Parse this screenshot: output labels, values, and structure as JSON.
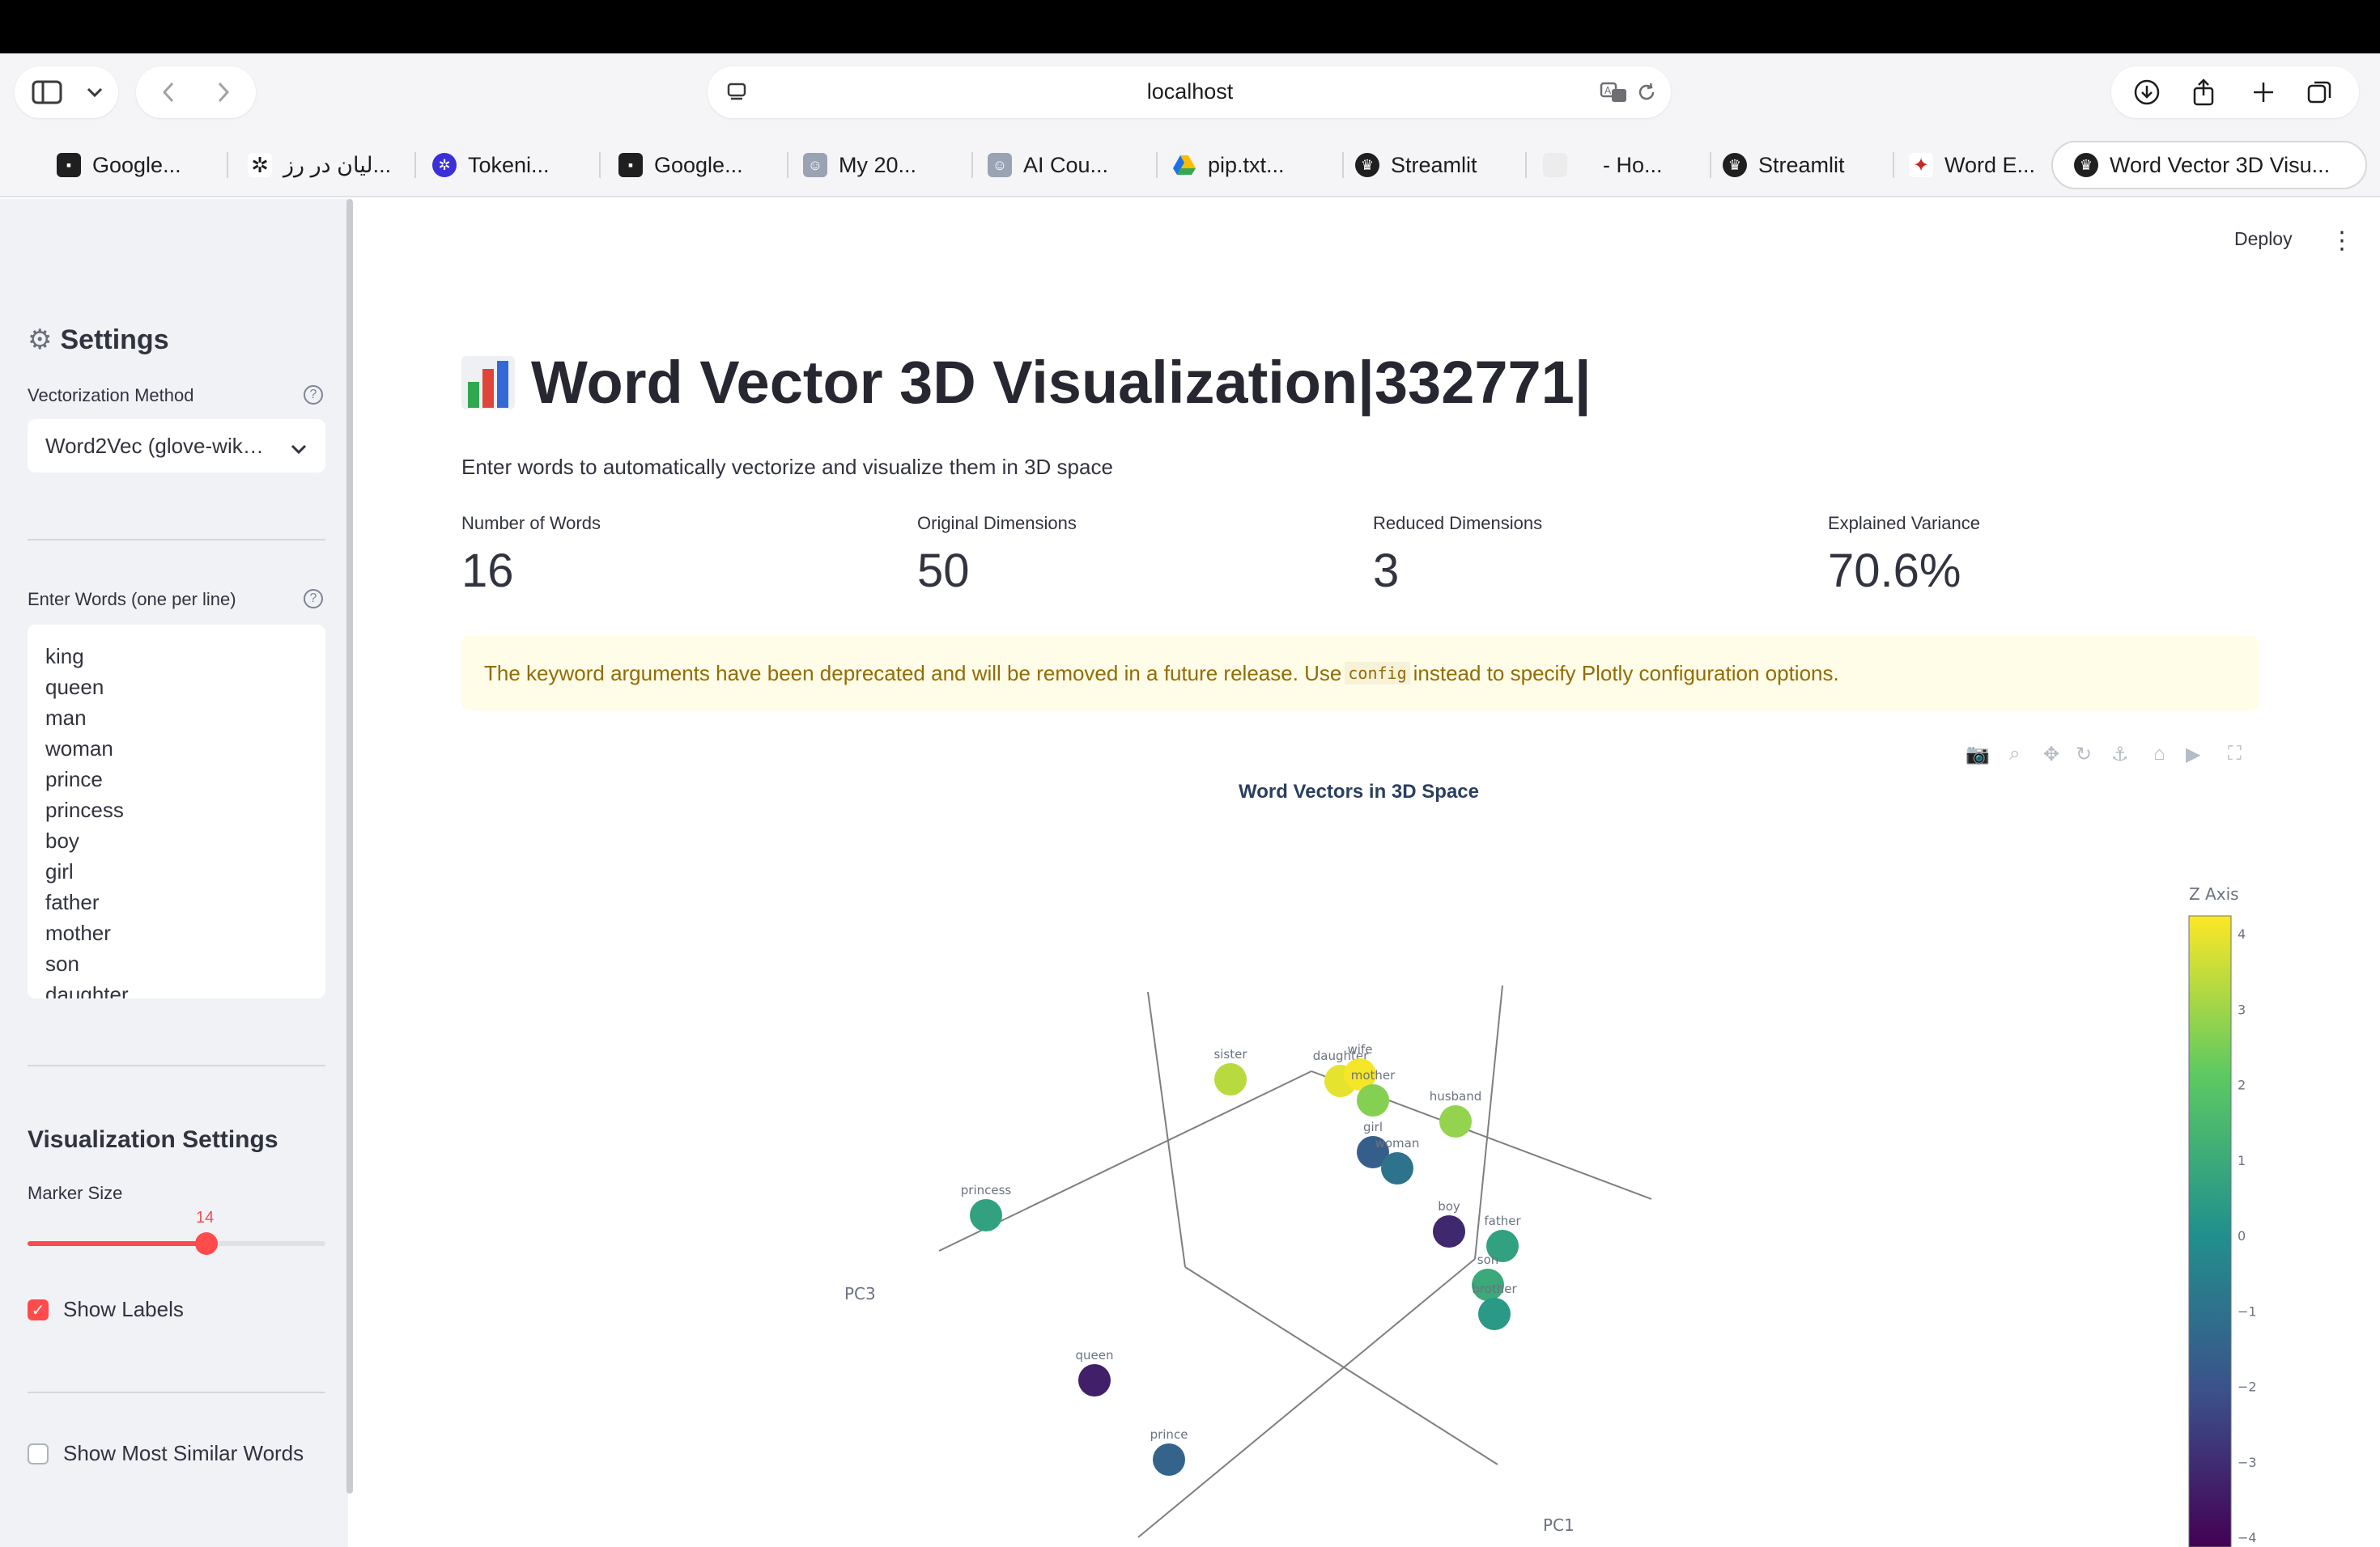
{
  "browser": {
    "url": "localhost",
    "tabs": [
      {
        "label": "Google...",
        "icon": "google-icon"
      },
      {
        "label": "لیان در رز...",
        "icon": "openai-icon"
      },
      {
        "label": "Tokeni...",
        "icon": "openai-icon"
      },
      {
        "label": "Google...",
        "icon": "google-icon"
      },
      {
        "label": "My 20...",
        "icon": "avatar-icon"
      },
      {
        "label": "AI Cou...",
        "icon": "avatar-icon"
      },
      {
        "label": "pip.txt...",
        "icon": "drive-icon"
      },
      {
        "label": "Streamlit",
        "icon": "streamlit-icon"
      },
      {
        "label": "- Ho...",
        "icon": "page-icon"
      },
      {
        "label": "Streamlit",
        "icon": "streamlit-icon"
      },
      {
        "label": "Word E...",
        "icon": "word-icon"
      },
      {
        "label": "Word Vector 3D Visu...",
        "icon": "streamlit-icon",
        "active": true
      }
    ]
  },
  "header": {
    "deploy": "Deploy",
    "menu": "⋮"
  },
  "sidebar": {
    "settings_title": "Settings",
    "settings_icon": "⚙️",
    "method_label": "Vectorization Method",
    "method_value": "Word2Vec (glove-wik…",
    "words_label": "Enter Words (one per line)",
    "words": [
      "king",
      "queen",
      "man",
      "woman",
      "prince",
      "princess",
      "boy",
      "girl",
      "father",
      "mother",
      "son",
      "daughter"
    ],
    "viz_title": "Visualization Settings",
    "marker_label": "Marker Size",
    "marker_value": "14",
    "marker_fraction": 0.6,
    "show_labels": "Show Labels",
    "show_labels_checked": true,
    "show_similar": "Show Most Similar Words",
    "show_similar_checked": false
  },
  "main": {
    "title": "Word Vector 3D Visualization|332771|",
    "subtitle": "Enter words to automatically vectorize and visualize them in 3D space",
    "metrics": [
      {
        "label": "Number of Words",
        "value": "16"
      },
      {
        "label": "Original Dimensions",
        "value": "50"
      },
      {
        "label": "Reduced Dimensions",
        "value": "3"
      },
      {
        "label": "Explained Variance",
        "value": "70.6%"
      }
    ],
    "warning_before": "The keyword arguments have been deprecated and will be removed in a future release. Use",
    "warning_code": "config",
    "warning_after": "instead to specify Plotly configuration options."
  },
  "chart_data": {
    "type": "scatter",
    "title": "Word Vectors in 3D Space",
    "axis_labels": {
      "x": "PC1",
      "z": "PC3"
    },
    "colorbar_title": "Z Axis",
    "colorbar_ticks": [
      "4",
      "3",
      "2",
      "1",
      "0",
      "−1",
      "−2",
      "−3",
      "−4"
    ],
    "colorscale": "viridis",
    "points": [
      {
        "label": "sister",
        "color": 3.3
      },
      {
        "label": "daughter",
        "color": 3.9
      },
      {
        "label": "wife",
        "color": 4.1
      },
      {
        "label": "mother",
        "color": 2.6
      },
      {
        "label": "husband",
        "color": 2.8
      },
      {
        "label": "girl",
        "color": -1.7
      },
      {
        "label": "woman",
        "color": -1.0
      },
      {
        "label": "princess",
        "color": 0.6
      },
      {
        "label": "boy",
        "color": -3.2
      },
      {
        "label": "father",
        "color": 0.6
      },
      {
        "label": "son",
        "color": 0.9
      },
      {
        "label": "brother",
        "color": 0.3
      },
      {
        "label": "queen",
        "color": -3.4
      },
      {
        "label": "prince",
        "color": -1.5
      }
    ]
  }
}
